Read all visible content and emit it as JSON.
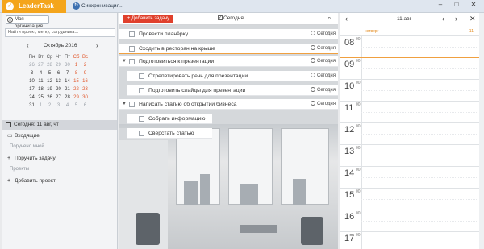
{
  "window": {
    "app_title": "LeaderTask",
    "sync_label": "Синхронизация...",
    "controls": [
      "–",
      "□",
      "✕"
    ]
  },
  "sidebar": {
    "org_button": "Моя организация",
    "search_placeholder": "Найти проект, метку, сотрудника...",
    "calendar": {
      "month_label": "Октябрь 2016",
      "weekdays": [
        "Пн",
        "Вт",
        "Ср",
        "Чт",
        "Пт",
        "Сб",
        "Вс"
      ],
      "weeks": [
        [
          "26",
          "27",
          "28",
          "29",
          "30",
          "1",
          "2"
        ],
        [
          "3",
          "4",
          "5",
          "6",
          "7",
          "8",
          "9"
        ],
        [
          "10",
          "11",
          "12",
          "13",
          "14",
          "15",
          "16"
        ],
        [
          "17",
          "18",
          "19",
          "20",
          "21",
          "22",
          "23"
        ],
        [
          "24",
          "25",
          "26",
          "27",
          "28",
          "29",
          "30"
        ],
        [
          "31",
          "1",
          "2",
          "3",
          "4",
          "5",
          "6"
        ]
      ]
    },
    "today_label": "Сегодня: 11 авг, чт",
    "inbox": "Входящие",
    "delegated_section": "Поручено мной",
    "delegate_task": "Поручить задачу",
    "projects_section": "Проекты",
    "add_project": "Добавить проект"
  },
  "tasks_panel": {
    "add_task": "Добавить задачу",
    "today_filter": "Сегодня",
    "tasks": [
      {
        "title": "Провести планёрку",
        "due": "Сегодня"
      },
      {
        "title": "Сходить в ресторан на крыше",
        "due": "Сегодня"
      },
      {
        "title": "Подготовиться к презентации",
        "due": "Сегодня"
      },
      {
        "title": "Отрепетировать речь для презентации",
        "due": "Сегодня"
      },
      {
        "title": "Подготовить слайды для презентации",
        "due": "Сегодня"
      },
      {
        "title": "Написать статью об открытии бизнеса",
        "due": "Сегодня"
      },
      {
        "title": "Собрать информацию",
        "due": ""
      },
      {
        "title": "Сверстать статью",
        "due": ""
      }
    ]
  },
  "day_panel": {
    "date_label": "11 авг",
    "weekday": "четверг",
    "day_number": "11",
    "hours": [
      "08",
      "09",
      "10",
      "11",
      "12",
      "13",
      "14",
      "15",
      "16",
      "17"
    ],
    "minutes": "00"
  }
}
